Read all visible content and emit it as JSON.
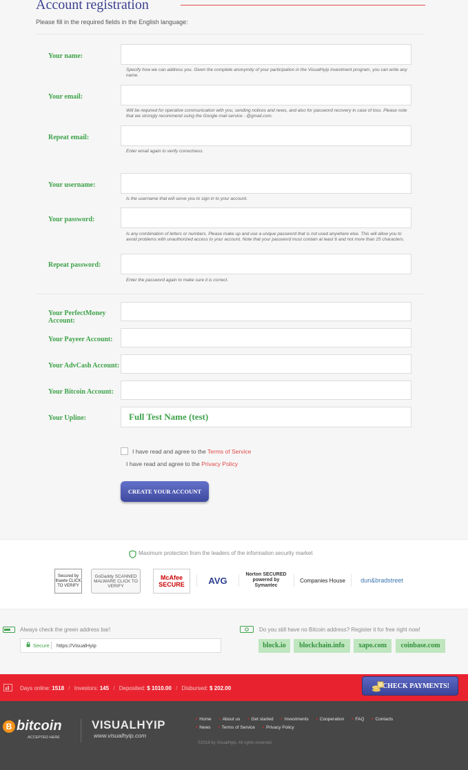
{
  "page": {
    "title": "Account registration",
    "subtitle": "Please fill in the required fields in the English language:"
  },
  "form": {
    "name_label": "Your name:",
    "name_hint": "Specify how we can address you. Given the complete anonymity of your participation in the VisualHyip investment program, you can write any name.",
    "email_label": "Your email:",
    "email_hint": "Will be required for operative communication with you, sending notices and news, and also for password recovery in case of loss. Please note that we strongly recommend using the Google mail service - @gmail.com.",
    "repeat_email_label": "Repeat email:",
    "repeat_email_hint": "Enter email again to verify correctness.",
    "username_label": "Your username:",
    "username_hint": "Is the username that will serve you to sign in to your account.",
    "password_label": "Your password:",
    "password_hint": "Is any combination of letters or numbers. Please make up and use a unique password that is not used anywhere else. This will allow you to avoid problems with unauthorized access to your account. Note that your password must contain at least 6 and not more than 25 characters.",
    "repeat_password_label": "Repeat password:",
    "repeat_password_hint": "Enter the password again to make sure it is correct.",
    "perfectmoney_label": "Your PerfectMoney Account:",
    "payeer_label": "Your Payeer Account:",
    "advcash_label": "Your AdvCash Account:",
    "bitcoin_label": "Your Bitcoin Account:",
    "upline_label": "Your Upline:",
    "upline_value": "Full Test Name (test)",
    "tos_text": "I have read and agree to the",
    "tos_link": "Terms of Service",
    "privacy_text": "I have read and agree to the",
    "privacy_link": "Privacy Policy",
    "submit_label": "CREATE YOUR ACCOUNT"
  },
  "security": {
    "headline": "Maximum protection from the leaders of the information security market",
    "logos": {
      "thawte": "Secured by thawte CLICK TO VERIFY",
      "godaddy": "GoDaddy SCANNED MALWARE CLICK TO VERIFY",
      "mcafee": "McAfee SECURE",
      "avg": "AVG",
      "norton": "Norton SECURED powered by Symantec",
      "companies": "Companies House",
      "dnb": "dun&bradstreet"
    }
  },
  "address": {
    "tip": "Always check the green address bar!",
    "secure": "Secure",
    "url": "https://VisualHyip"
  },
  "bitcoin_reg": {
    "tip": "Do you still have no Bitcoin address? Register it for free right now!",
    "services": [
      "block.io",
      "blockchain.info",
      "xapo.com",
      "coinbase.com"
    ]
  },
  "stats": {
    "days_label": "Days online:",
    "days": "1518",
    "investors_label": "Investors:",
    "investors": "145",
    "deposited_label": "Deposited:",
    "deposited": "$ 1010.00",
    "disbursed_label": "Disbursed:",
    "disbursed": "$ 202.00",
    "check_button": "CHECK PAYMENTS!"
  },
  "footer": {
    "bitcoin_logo": "bitcoin",
    "bitcoin_sub": "ACCEPTED HERE",
    "brand": "VISUALHYIP",
    "brand_url": "www.visualhyip.com",
    "nav_row1": [
      "Home",
      "About us",
      "Get started",
      "Investments",
      "Cooperation",
      "FAQ",
      "Contacts"
    ],
    "nav_row2": [
      "News",
      "Terms of Service",
      "Privacy Policy"
    ],
    "copyright": "©2018 by VisualHyip. All rights reserved."
  },
  "colors": {
    "accent_green": "#3ea24a",
    "title_blue": "#3b3f8f",
    "red_bar": "#e8232f",
    "footer_bg": "#474747"
  }
}
